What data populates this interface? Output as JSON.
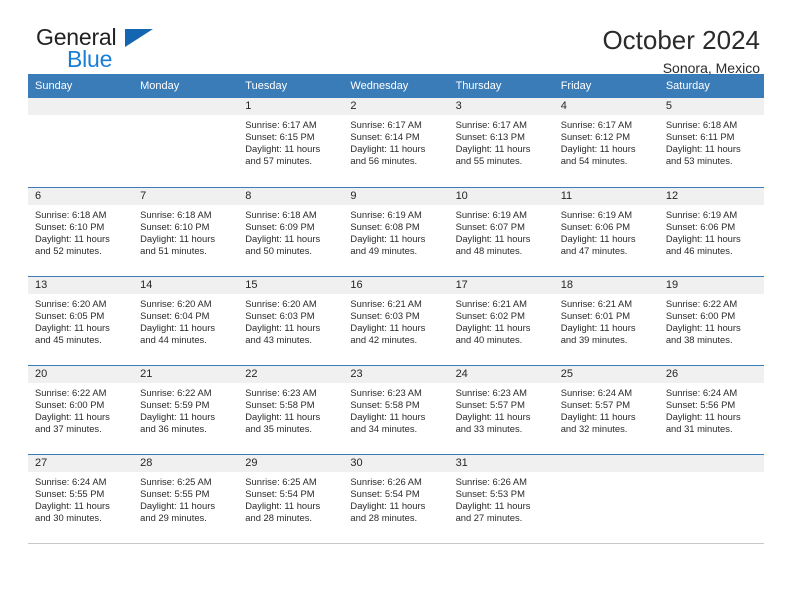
{
  "brand": {
    "name_part1": "General",
    "name_part2": "Blue",
    "mark": "triangle-icon"
  },
  "header": {
    "title": "October 2024",
    "subtitle": "Sonora, Mexico"
  },
  "weekday_headers": [
    "Sunday",
    "Monday",
    "Tuesday",
    "Wednesday",
    "Thursday",
    "Friday",
    "Saturday"
  ],
  "colors": {
    "header_blue": "#3a7cb8",
    "brand_blue": "#1a7fd4",
    "mark_blue": "#1566b0",
    "daynum_band": "#f0f0f0",
    "text": "#2a2a2a"
  },
  "weeks": [
    [
      {
        "day": "",
        "sunrise": "",
        "sunset": "",
        "daylight1": "",
        "daylight2": ""
      },
      {
        "day": "",
        "sunrise": "",
        "sunset": "",
        "daylight1": "",
        "daylight2": ""
      },
      {
        "day": "1",
        "sunrise": "Sunrise: 6:17 AM",
        "sunset": "Sunset: 6:15 PM",
        "daylight1": "Daylight: 11 hours",
        "daylight2": "and 57 minutes."
      },
      {
        "day": "2",
        "sunrise": "Sunrise: 6:17 AM",
        "sunset": "Sunset: 6:14 PM",
        "daylight1": "Daylight: 11 hours",
        "daylight2": "and 56 minutes."
      },
      {
        "day": "3",
        "sunrise": "Sunrise: 6:17 AM",
        "sunset": "Sunset: 6:13 PM",
        "daylight1": "Daylight: 11 hours",
        "daylight2": "and 55 minutes."
      },
      {
        "day": "4",
        "sunrise": "Sunrise: 6:17 AM",
        "sunset": "Sunset: 6:12 PM",
        "daylight1": "Daylight: 11 hours",
        "daylight2": "and 54 minutes."
      },
      {
        "day": "5",
        "sunrise": "Sunrise: 6:18 AM",
        "sunset": "Sunset: 6:11 PM",
        "daylight1": "Daylight: 11 hours",
        "daylight2": "and 53 minutes."
      }
    ],
    [
      {
        "day": "6",
        "sunrise": "Sunrise: 6:18 AM",
        "sunset": "Sunset: 6:10 PM",
        "daylight1": "Daylight: 11 hours",
        "daylight2": "and 52 minutes."
      },
      {
        "day": "7",
        "sunrise": "Sunrise: 6:18 AM",
        "sunset": "Sunset: 6:10 PM",
        "daylight1": "Daylight: 11 hours",
        "daylight2": "and 51 minutes."
      },
      {
        "day": "8",
        "sunrise": "Sunrise: 6:18 AM",
        "sunset": "Sunset: 6:09 PM",
        "daylight1": "Daylight: 11 hours",
        "daylight2": "and 50 minutes."
      },
      {
        "day": "9",
        "sunrise": "Sunrise: 6:19 AM",
        "sunset": "Sunset: 6:08 PM",
        "daylight1": "Daylight: 11 hours",
        "daylight2": "and 49 minutes."
      },
      {
        "day": "10",
        "sunrise": "Sunrise: 6:19 AM",
        "sunset": "Sunset: 6:07 PM",
        "daylight1": "Daylight: 11 hours",
        "daylight2": "and 48 minutes."
      },
      {
        "day": "11",
        "sunrise": "Sunrise: 6:19 AM",
        "sunset": "Sunset: 6:06 PM",
        "daylight1": "Daylight: 11 hours",
        "daylight2": "and 47 minutes."
      },
      {
        "day": "12",
        "sunrise": "Sunrise: 6:19 AM",
        "sunset": "Sunset: 6:06 PM",
        "daylight1": "Daylight: 11 hours",
        "daylight2": "and 46 minutes."
      }
    ],
    [
      {
        "day": "13",
        "sunrise": "Sunrise: 6:20 AM",
        "sunset": "Sunset: 6:05 PM",
        "daylight1": "Daylight: 11 hours",
        "daylight2": "and 45 minutes."
      },
      {
        "day": "14",
        "sunrise": "Sunrise: 6:20 AM",
        "sunset": "Sunset: 6:04 PM",
        "daylight1": "Daylight: 11 hours",
        "daylight2": "and 44 minutes."
      },
      {
        "day": "15",
        "sunrise": "Sunrise: 6:20 AM",
        "sunset": "Sunset: 6:03 PM",
        "daylight1": "Daylight: 11 hours",
        "daylight2": "and 43 minutes."
      },
      {
        "day": "16",
        "sunrise": "Sunrise: 6:21 AM",
        "sunset": "Sunset: 6:03 PM",
        "daylight1": "Daylight: 11 hours",
        "daylight2": "and 42 minutes."
      },
      {
        "day": "17",
        "sunrise": "Sunrise: 6:21 AM",
        "sunset": "Sunset: 6:02 PM",
        "daylight1": "Daylight: 11 hours",
        "daylight2": "and 40 minutes."
      },
      {
        "day": "18",
        "sunrise": "Sunrise: 6:21 AM",
        "sunset": "Sunset: 6:01 PM",
        "daylight1": "Daylight: 11 hours",
        "daylight2": "and 39 minutes."
      },
      {
        "day": "19",
        "sunrise": "Sunrise: 6:22 AM",
        "sunset": "Sunset: 6:00 PM",
        "daylight1": "Daylight: 11 hours",
        "daylight2": "and 38 minutes."
      }
    ],
    [
      {
        "day": "20",
        "sunrise": "Sunrise: 6:22 AM",
        "sunset": "Sunset: 6:00 PM",
        "daylight1": "Daylight: 11 hours",
        "daylight2": "and 37 minutes."
      },
      {
        "day": "21",
        "sunrise": "Sunrise: 6:22 AM",
        "sunset": "Sunset: 5:59 PM",
        "daylight1": "Daylight: 11 hours",
        "daylight2": "and 36 minutes."
      },
      {
        "day": "22",
        "sunrise": "Sunrise: 6:23 AM",
        "sunset": "Sunset: 5:58 PM",
        "daylight1": "Daylight: 11 hours",
        "daylight2": "and 35 minutes."
      },
      {
        "day": "23",
        "sunrise": "Sunrise: 6:23 AM",
        "sunset": "Sunset: 5:58 PM",
        "daylight1": "Daylight: 11 hours",
        "daylight2": "and 34 minutes."
      },
      {
        "day": "24",
        "sunrise": "Sunrise: 6:23 AM",
        "sunset": "Sunset: 5:57 PM",
        "daylight1": "Daylight: 11 hours",
        "daylight2": "and 33 minutes."
      },
      {
        "day": "25",
        "sunrise": "Sunrise: 6:24 AM",
        "sunset": "Sunset: 5:57 PM",
        "daylight1": "Daylight: 11 hours",
        "daylight2": "and 32 minutes."
      },
      {
        "day": "26",
        "sunrise": "Sunrise: 6:24 AM",
        "sunset": "Sunset: 5:56 PM",
        "daylight1": "Daylight: 11 hours",
        "daylight2": "and 31 minutes."
      }
    ],
    [
      {
        "day": "27",
        "sunrise": "Sunrise: 6:24 AM",
        "sunset": "Sunset: 5:55 PM",
        "daylight1": "Daylight: 11 hours",
        "daylight2": "and 30 minutes."
      },
      {
        "day": "28",
        "sunrise": "Sunrise: 6:25 AM",
        "sunset": "Sunset: 5:55 PM",
        "daylight1": "Daylight: 11 hours",
        "daylight2": "and 29 minutes."
      },
      {
        "day": "29",
        "sunrise": "Sunrise: 6:25 AM",
        "sunset": "Sunset: 5:54 PM",
        "daylight1": "Daylight: 11 hours",
        "daylight2": "and 28 minutes."
      },
      {
        "day": "30",
        "sunrise": "Sunrise: 6:26 AM",
        "sunset": "Sunset: 5:54 PM",
        "daylight1": "Daylight: 11 hours",
        "daylight2": "and 28 minutes."
      },
      {
        "day": "31",
        "sunrise": "Sunrise: 6:26 AM",
        "sunset": "Sunset: 5:53 PM",
        "daylight1": "Daylight: 11 hours",
        "daylight2": "and 27 minutes."
      },
      {
        "day": "",
        "sunrise": "",
        "sunset": "",
        "daylight1": "",
        "daylight2": ""
      },
      {
        "day": "",
        "sunrise": "",
        "sunset": "",
        "daylight1": "",
        "daylight2": ""
      }
    ]
  ]
}
